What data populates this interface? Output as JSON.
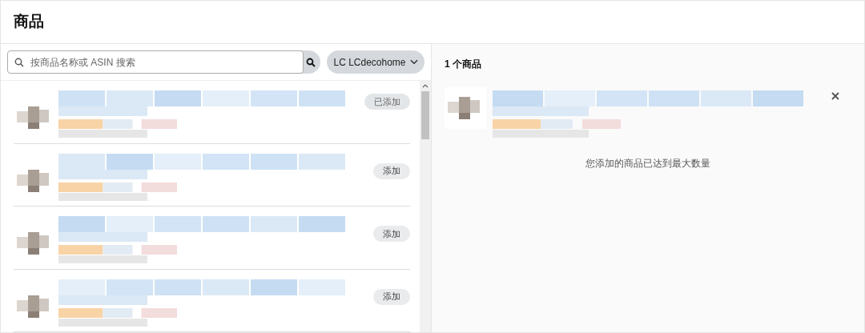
{
  "header": {
    "title": "商品"
  },
  "search": {
    "placeholder": "按商品名称或 ASIN 搜索"
  },
  "store_select": {
    "value": "LC LCdecohome"
  },
  "products": [
    {
      "kind": "picture",
      "action": "已添加",
      "added": true
    },
    {
      "kind": "picture",
      "action": "添加",
      "added": false
    },
    {
      "kind": "picture",
      "action": "添加",
      "added": false
    },
    {
      "kind": "picture",
      "action": "添加",
      "added": false
    }
  ],
  "selected_panel": {
    "count_label": "1 个商品",
    "notice": "您添加的商品已达到最大数量"
  }
}
